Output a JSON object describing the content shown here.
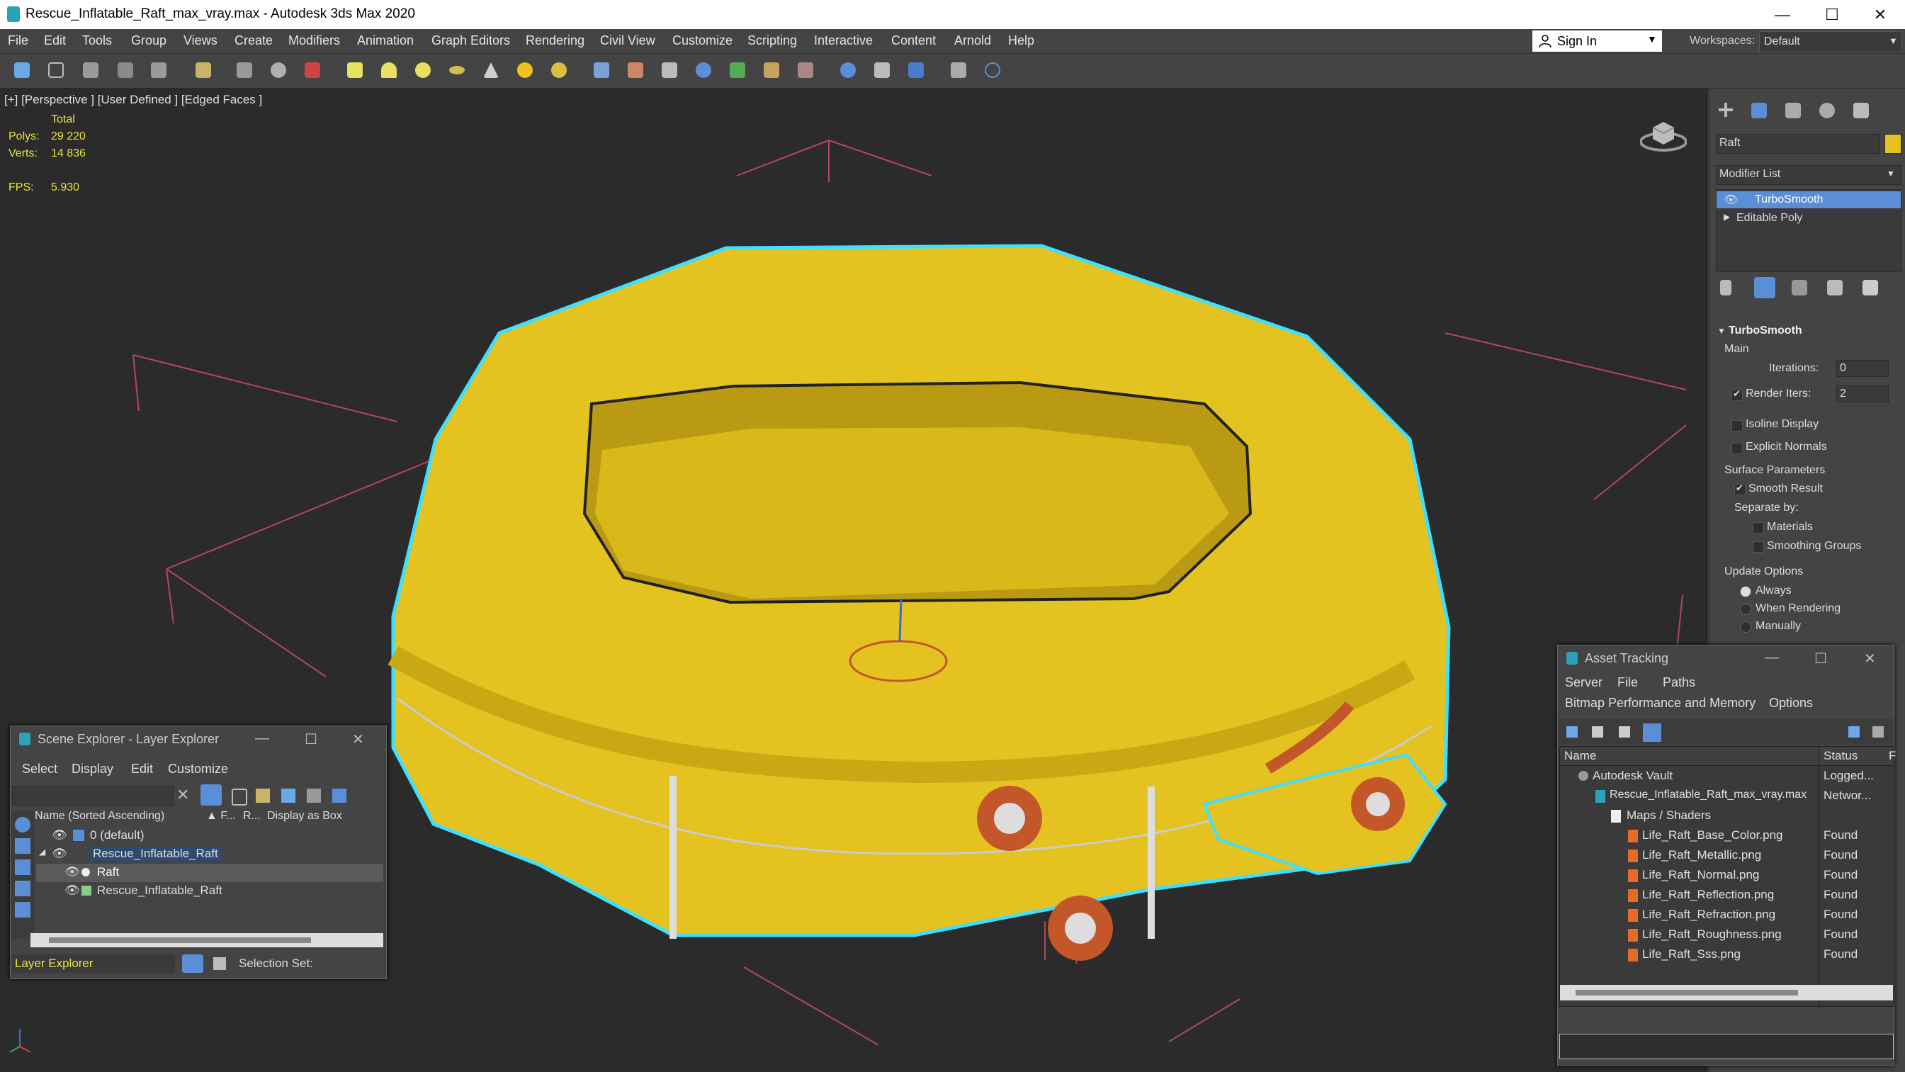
{
  "window": {
    "title": "Rescue_Inflatable_Raft_max_vray.max - Autodesk 3ds Max 2020",
    "minimize": "—",
    "maximize": "☐",
    "close": "✕"
  },
  "menu": [
    "File",
    "Edit",
    "Tools",
    "Group",
    "Views",
    "Create",
    "Modifiers",
    "Animation",
    "Graph Editors",
    "Rendering",
    "Civil View",
    "Customize",
    "Scripting",
    "Interactive",
    "Content",
    "Arnold",
    "Help"
  ],
  "signin": {
    "label": "Sign In"
  },
  "workspace": {
    "label": "Workspaces:",
    "value": "Default"
  },
  "viewport": {
    "label": "[+] [Perspective ] [User Defined ] [Edged Faces ]",
    "stats": {
      "total_label": "Total",
      "polys_label": "Polys:",
      "polys": "29 220",
      "verts_label": "Verts:",
      "verts": "14 836",
      "fps_label": "FPS:",
      "fps": "5.930"
    }
  },
  "command_panel": {
    "object_name": "Raft",
    "modifier_list": "Modifier List",
    "stack": [
      "TurboSmooth",
      "Editable Poly"
    ],
    "rollout_title": "TurboSmooth",
    "main_label": "Main",
    "iterations_label": "Iterations:",
    "iterations": "0",
    "render_iters_label": "Render Iters:",
    "render_iters": "2",
    "isoline": "Isoline Display",
    "explicit_normals": "Explicit Normals",
    "surface_params": "Surface Parameters",
    "smooth_result": "Smooth Result",
    "separate_by": "Separate by:",
    "materials": "Materials",
    "smoothing_groups": "Smoothing Groups",
    "update_options": "Update Options",
    "always": "Always",
    "when_rendering": "When Rendering",
    "manually": "Manually"
  },
  "scene_explorer": {
    "title": "Scene Explorer - Layer Explorer",
    "menu": [
      "Select",
      "Display",
      "Edit",
      "Customize"
    ],
    "columns": {
      "name": "Name (Sorted Ascending)",
      "f": "▲ F...",
      "r": "R...",
      "display": "Display as Box"
    },
    "rows": [
      "0 (default)",
      "Rescue_Inflatable_Raft",
      "Raft",
      "Rescue_Inflatable_Raft"
    ],
    "footer_mode": "Layer Explorer",
    "selection_set": "Selection Set:"
  },
  "asset_tracking": {
    "title": "Asset Tracking",
    "menu1": [
      "Server",
      "File",
      "Paths"
    ],
    "menu2": [
      "Bitmap Performance and Memory",
      "Options"
    ],
    "columns": {
      "name": "Name",
      "status": "Status",
      "extra": "F"
    },
    "rows": [
      {
        "name": "Autodesk Vault",
        "status": "Logged..."
      },
      {
        "name": "Rescue_Inflatable_Raft_max_vray.max",
        "status": "Networ..."
      },
      {
        "name": "Maps / Shaders",
        "status": ""
      },
      {
        "name": "Life_Raft_Base_Color.png",
        "status": "Found"
      },
      {
        "name": "Life_Raft_Metallic.png",
        "status": "Found"
      },
      {
        "name": "Life_Raft_Normal.png",
        "status": "Found"
      },
      {
        "name": "Life_Raft_Reflection.png",
        "status": "Found"
      },
      {
        "name": "Life_Raft_Refraction.png",
        "status": "Found"
      },
      {
        "name": "Life_Raft_Roughness.png",
        "status": "Found"
      },
      {
        "name": "Life_Raft_Sss.png",
        "status": "Found"
      }
    ]
  },
  "colors": {
    "raft": "#e4c21f",
    "selection_outline": "#3fe0ff",
    "grid": "#b2475e",
    "highlight": "#5a8fd8"
  }
}
